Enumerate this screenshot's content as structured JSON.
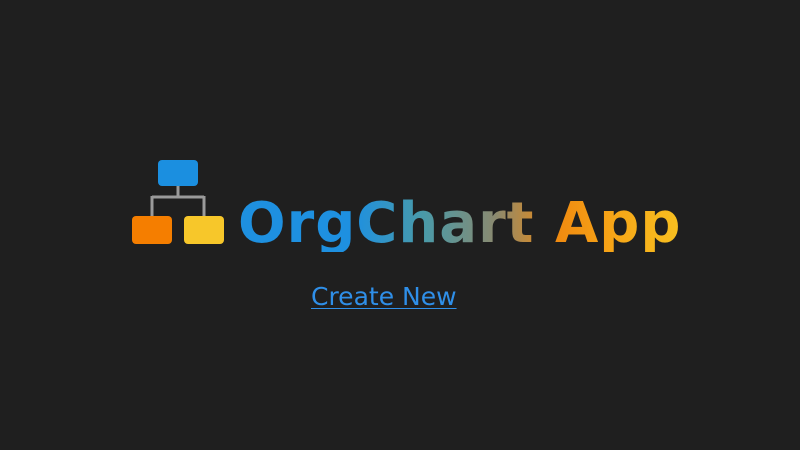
{
  "app": {
    "title": "OrgChart App",
    "logo_icon": "org-chart-icon"
  },
  "actions": {
    "create_new_label": "Create New"
  },
  "colors": {
    "background": "#1f1f1f",
    "logo_top": "#1b8fe0",
    "logo_left": "#f57e00",
    "logo_right": "#f7c72a",
    "logo_connector": "#9a9a9a",
    "title_start": "#1e90e0",
    "title_end": "#f7c020",
    "link": "#2f8fe8"
  }
}
